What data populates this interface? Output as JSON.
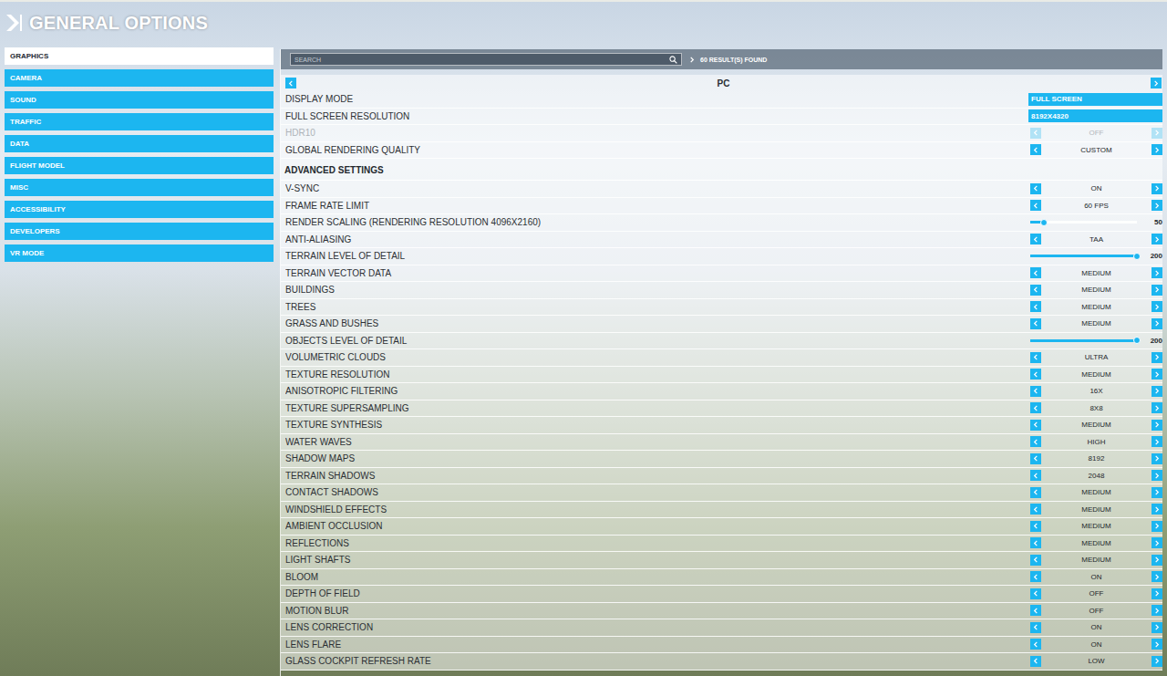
{
  "header": {
    "title": "GENERAL OPTIONS"
  },
  "sidebar": {
    "items": [
      {
        "label": "GRAPHICS",
        "selected": true
      },
      {
        "label": "CAMERA",
        "selected": false
      },
      {
        "label": "SOUND",
        "selected": false
      },
      {
        "label": "TRAFFIC",
        "selected": false
      },
      {
        "label": "DATA",
        "selected": false
      },
      {
        "label": "FLIGHT MODEL",
        "selected": false
      },
      {
        "label": "MISC",
        "selected": false
      },
      {
        "label": "ACCESSIBILITY",
        "selected": false
      },
      {
        "label": "DEVELOPERS",
        "selected": false
      },
      {
        "label": "VR MODE",
        "selected": false
      }
    ]
  },
  "search": {
    "placeholder": "SEARCH",
    "results": "60 RESULT(S) FOUND"
  },
  "category": {
    "label": "PC"
  },
  "basic_settings": [
    {
      "label": "DISPLAY MODE",
      "kind": "field",
      "value": "FULL SCREEN",
      "disabled": false
    },
    {
      "label": "FULL SCREEN RESOLUTION",
      "kind": "field",
      "value": "8192X4320",
      "disabled": false
    },
    {
      "label": "HDR10",
      "kind": "selector",
      "value": "OFF",
      "disabled": true
    },
    {
      "label": "GLOBAL RENDERING QUALITY",
      "kind": "selector",
      "value": "CUSTOM",
      "disabled": false
    }
  ],
  "advanced_settings": {
    "title": "ADVANCED SETTINGS",
    "settings": [
      {
        "label": "V-SYNC",
        "kind": "selector",
        "value": "ON",
        "disabled": false
      },
      {
        "label": "FRAME RATE LIMIT",
        "kind": "selector",
        "value": "60 FPS",
        "disabled": false
      },
      {
        "label": "RENDER SCALING (RENDERING RESOLUTION 4096X2160)",
        "kind": "slider",
        "value": "50",
        "level": 0.13,
        "disabled": false
      },
      {
        "label": "ANTI-ALIASING",
        "kind": "selector",
        "value": "TAA",
        "disabled": false
      },
      {
        "label": "TERRAIN LEVEL OF DETAIL",
        "kind": "slider",
        "value": "200",
        "level": 1,
        "disabled": false
      },
      {
        "label": "TERRAIN VECTOR DATA",
        "kind": "selector",
        "value": "MEDIUM",
        "disabled": false
      },
      {
        "label": "BUILDINGS",
        "kind": "selector",
        "value": "MEDIUM",
        "disabled": false
      },
      {
        "label": "TREES",
        "kind": "selector",
        "value": "MEDIUM",
        "disabled": false
      },
      {
        "label": "GRASS AND BUSHES",
        "kind": "selector",
        "value": "MEDIUM",
        "disabled": false
      },
      {
        "label": "OBJECTS LEVEL OF DETAIL",
        "kind": "slider",
        "value": "200",
        "level": 1,
        "disabled": false
      },
      {
        "label": "VOLUMETRIC CLOUDS",
        "kind": "selector",
        "value": "ULTRA",
        "disabled": false
      },
      {
        "label": "TEXTURE RESOLUTION",
        "kind": "selector",
        "value": "MEDIUM",
        "disabled": false
      },
      {
        "label": "ANISOTROPIC FILTERING",
        "kind": "selector",
        "value": "16X",
        "disabled": false
      },
      {
        "label": "TEXTURE SUPERSAMPLING",
        "kind": "selector",
        "value": "8X8",
        "disabled": false
      },
      {
        "label": "TEXTURE SYNTHESIS",
        "kind": "selector",
        "value": "MEDIUM",
        "disabled": false
      },
      {
        "label": "WATER WAVES",
        "kind": "selector",
        "value": "HIGH",
        "disabled": false
      },
      {
        "label": "SHADOW MAPS",
        "kind": "selector",
        "value": "8192",
        "disabled": false
      },
      {
        "label": "TERRAIN SHADOWS",
        "kind": "selector",
        "value": "2048",
        "disabled": false
      },
      {
        "label": "CONTACT SHADOWS",
        "kind": "selector",
        "value": "MEDIUM",
        "disabled": false
      },
      {
        "label": "WINDSHIELD EFFECTS",
        "kind": "selector",
        "value": "MEDIUM",
        "disabled": false
      },
      {
        "label": "AMBIENT OCCLUSION",
        "kind": "selector",
        "value": "MEDIUM",
        "disabled": false
      },
      {
        "label": "REFLECTIONS",
        "kind": "selector",
        "value": "MEDIUM",
        "disabled": false
      },
      {
        "label": "LIGHT SHAFTS",
        "kind": "selector",
        "value": "MEDIUM",
        "disabled": false
      },
      {
        "label": "BLOOM",
        "kind": "selector",
        "value": "ON",
        "disabled": false
      },
      {
        "label": "DEPTH OF FIELD",
        "kind": "selector",
        "value": "OFF",
        "disabled": false
      },
      {
        "label": "MOTION BLUR",
        "kind": "selector",
        "value": "OFF",
        "disabled": false
      },
      {
        "label": "LENS CORRECTION",
        "kind": "selector",
        "value": "ON",
        "disabled": false
      },
      {
        "label": "LENS FLARE",
        "kind": "selector",
        "value": "ON",
        "disabled": false
      },
      {
        "label": "GLASS COCKPIT REFRESH RATE",
        "kind": "selector",
        "value": "LOW",
        "disabled": false
      }
    ]
  }
}
